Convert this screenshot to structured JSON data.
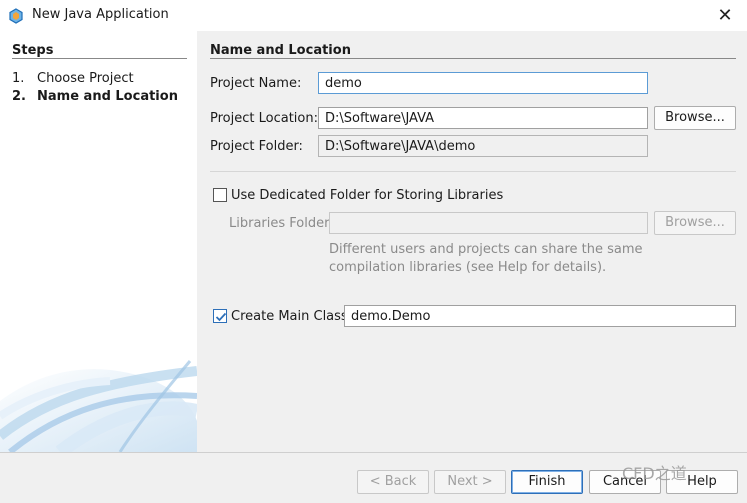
{
  "window": {
    "title": "New Java Application",
    "close_symbol": "✕"
  },
  "steps": {
    "title": "Steps",
    "items": [
      {
        "num": "1.",
        "label": "Choose Project"
      },
      {
        "num": "2.",
        "label": "Name and Location"
      }
    ]
  },
  "section": {
    "title": "Name and Location"
  },
  "form": {
    "project_name_label": "Project Name:",
    "project_name_value": "demo",
    "project_location_label": "Project Location:",
    "project_location_value": "D:\\Software\\JAVA",
    "browse_label": "Browse...",
    "project_folder_label": "Project Folder:",
    "project_folder_value": "D:\\Software\\JAVA\\demo",
    "dedicated_folder_label": "Use Dedicated Folder for Storing Libraries",
    "dedicated_folder_checked": false,
    "libraries_folder_label": "Libraries Folder:",
    "libraries_folder_value": "",
    "libraries_browse_label": "Browse...",
    "hint_line1": "Different users and projects can share the same",
    "hint_line2": "compilation libraries (see Help for details).",
    "create_main_class_label": "Create Main Class",
    "create_main_class_checked": true,
    "main_class_value": "demo.Demo"
  },
  "footer": {
    "back_label": "< Back",
    "next_label": "Next >",
    "finish_label": "Finish",
    "cancel_label": "Cancel",
    "help_label": "Help",
    "watermark": "CFD之道"
  },
  "colors": {
    "accent": "#2d6fb8",
    "panel": "#f0f0f0",
    "disabled_text": "#8a8a8a"
  }
}
